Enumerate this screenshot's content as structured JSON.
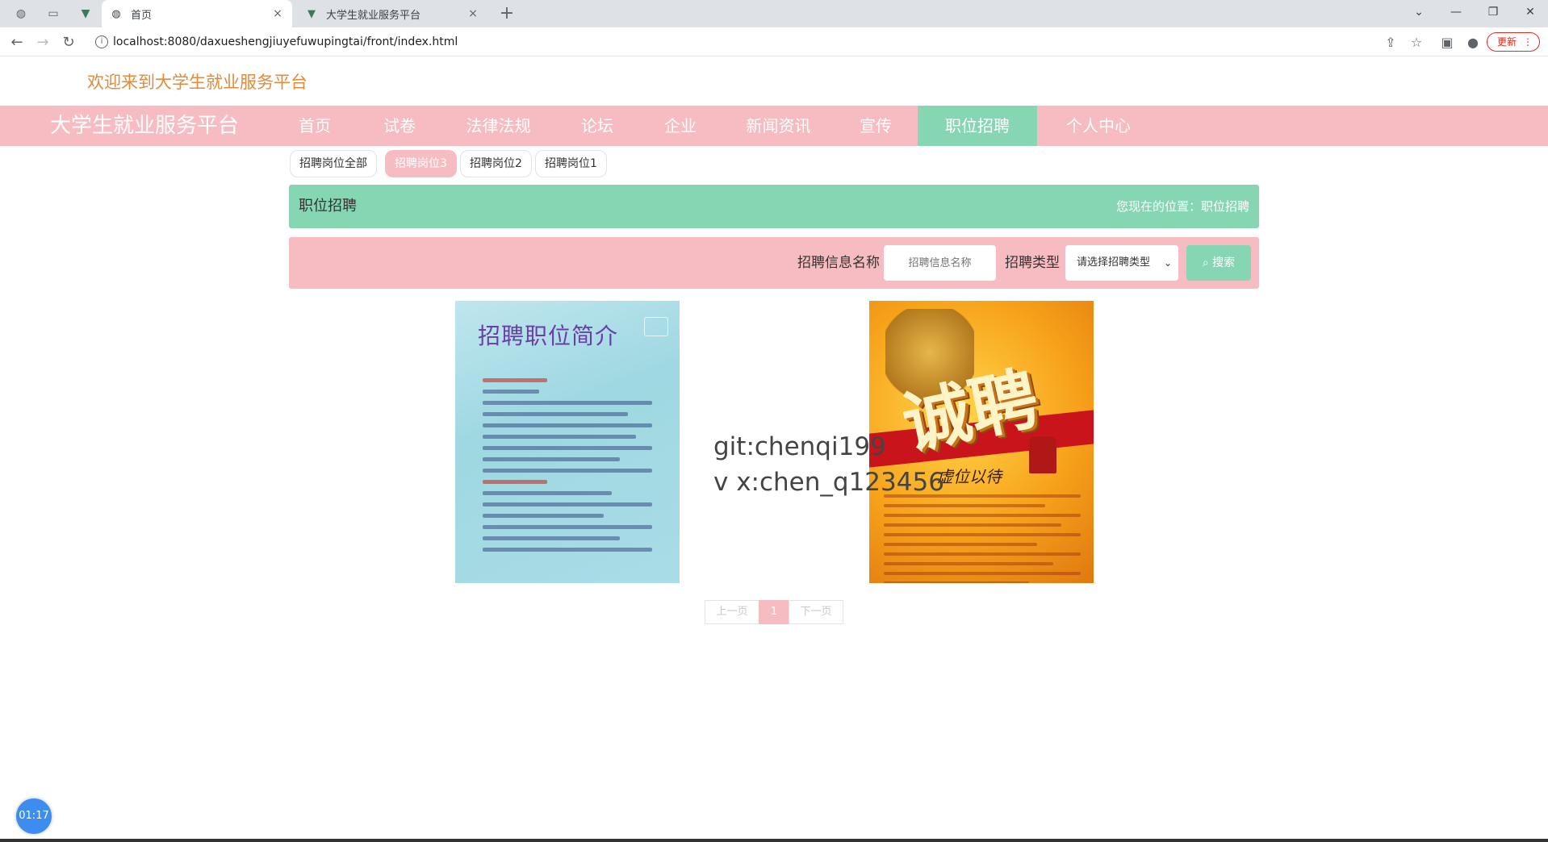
{
  "browser": {
    "tabs": [
      {
        "title": "首页",
        "active": true
      },
      {
        "title": "大学生就业服务平台",
        "active": false
      }
    ],
    "url": "localhost:8080/daxueshengjiuyefuwupingtai/front/index.html",
    "update_label": "更新"
  },
  "page": {
    "welcome": "欢迎来到大学生就业服务平台",
    "brand": "大学生就业服务平台",
    "nav": [
      {
        "label": "首页"
      },
      {
        "label": "试卷"
      },
      {
        "label": "法律法规"
      },
      {
        "label": "论坛"
      },
      {
        "label": "企业"
      },
      {
        "label": "新闻资讯"
      },
      {
        "label": "宣传"
      },
      {
        "label": "职位招聘",
        "active": true
      },
      {
        "label": "个人中心"
      }
    ],
    "subtabs": [
      {
        "label": "招聘岗位全部"
      },
      {
        "label": "招聘岗位3",
        "active": true
      },
      {
        "label": "招聘岗位2"
      },
      {
        "label": "招聘岗位1"
      }
    ],
    "section_title": "职位招聘",
    "breadcrumb": "您现在的位置：职位招聘",
    "search": {
      "name_label": "招聘信息名称",
      "name_placeholder": "招聘信息名称",
      "type_label": "招聘类型",
      "type_selected": "请选择招聘类型",
      "button_label": "搜索"
    },
    "cards": [
      {
        "poster_heading": "招聘职位简介"
      },
      {
        "poster_heading": "诚聘",
        "poster_motto": "虚位以待"
      }
    ],
    "watermark": {
      "line1": "git:chenqi199",
      "line2": "v x:chen_q123456"
    },
    "pagination": {
      "prev": "上一页",
      "current": "1",
      "next": "下一页"
    },
    "timer": "01:17"
  },
  "colors": {
    "pink": "#f7bcc2",
    "green": "#86d6b4",
    "welcome_orange": "#e28b3c"
  }
}
